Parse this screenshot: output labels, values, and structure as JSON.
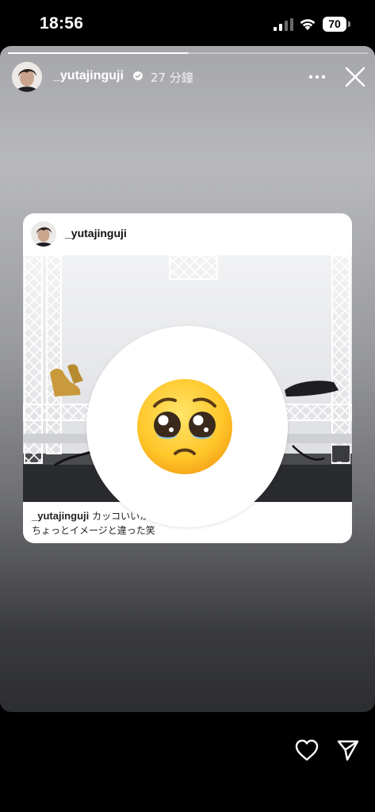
{
  "status_bar": {
    "time": "18:56",
    "battery_level": "70",
    "icons": [
      "signal-icon",
      "wifi-icon",
      "battery-icon"
    ]
  },
  "story": {
    "progress": 0.5,
    "username": "_yutajinguji",
    "time_ago": "27 分鐘",
    "icons": [
      "verified-icon",
      "more-icon",
      "close-icon"
    ]
  },
  "shared_post": {
    "username": "_yutajinguji",
    "caption_user": "_yutajinguji",
    "caption_line1": "カッコいいかなと思ったら",
    "caption_line2": "ちょっとイメージと違った笑"
  },
  "sticker": {
    "icon": "pleading-face-emoji"
  },
  "bottom_bar": {
    "icons": [
      "heart-icon",
      "send-icon"
    ]
  },
  "colors": {
    "accent": "#ffffff",
    "verified": "#ffffff",
    "background": "#000000"
  }
}
